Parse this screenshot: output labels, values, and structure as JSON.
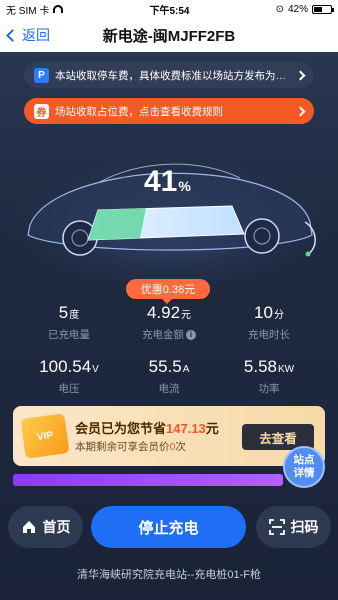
{
  "status_bar": {
    "carrier": "无 SIM 卡",
    "time": "下午5:54",
    "battery": "42%",
    "battery_level": 0.42
  },
  "nav": {
    "back_label": "返回",
    "title": "新电途-闽MJFF2FB"
  },
  "notices": [
    {
      "icon": "P",
      "text": "本站收取停车费，具体收费标准以场站方发布为准..."
    },
    {
      "icon": "券",
      "text": "场站收取占位费，点击查看收费规则"
    }
  ],
  "charge": {
    "percent": "41",
    "percent_sign": "%",
    "percent_value": 41
  },
  "discount_label": "优惠0.38元",
  "stats": [
    {
      "value": "5",
      "unit": "度",
      "label": "已充电量"
    },
    {
      "value": "4.92",
      "unit": "元",
      "label": "充电金额",
      "info": "i"
    },
    {
      "value": "10",
      "unit": "分",
      "label": "充电时长"
    },
    {
      "value": "100.54",
      "unit": "V",
      "label": "电压"
    },
    {
      "value": "55.5",
      "unit": "A",
      "label": "电流"
    },
    {
      "value": "5.58",
      "unit": "KW",
      "label": "功率"
    }
  ],
  "member": {
    "vip_label": "VIP",
    "title_prefix": "会员已为您节省",
    "saved": "147.13",
    "title_suffix": "元",
    "sub_prefix": "本期剩余可享会员价",
    "remain": "0",
    "sub_suffix": "次",
    "button": "去查看"
  },
  "fab": {
    "line1": "站点",
    "line2": "详情"
  },
  "bottom": {
    "home": "首页",
    "stop": "停止充电",
    "scan": "扫码"
  },
  "footer": "清华海峡研究院充电站--充电桩01-F枪",
  "colors": {
    "accent": "#1e6ff6",
    "orange": "#f35a25",
    "background": "#1f2a41"
  }
}
